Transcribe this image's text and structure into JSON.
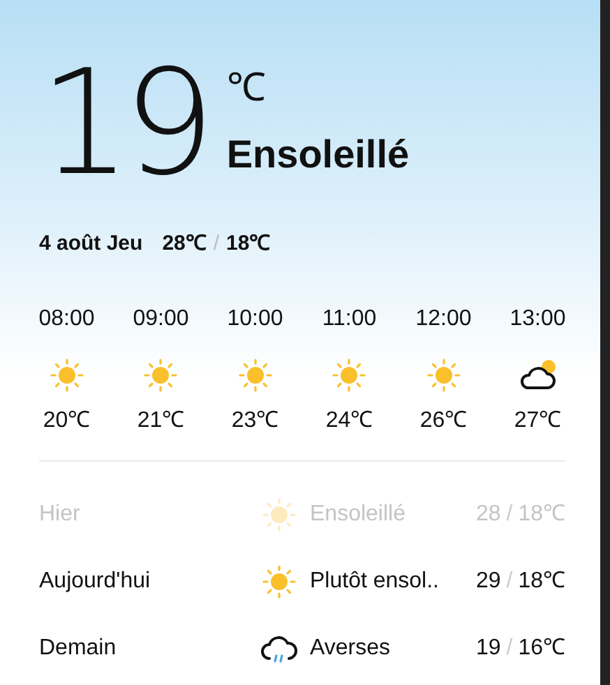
{
  "current": {
    "temperature": "19",
    "unit": "℃",
    "condition": "Ensoleillé"
  },
  "today": {
    "date": "4 août Jeu",
    "high": "28℃",
    "separator": "/",
    "low": "18℃"
  },
  "hourly": [
    {
      "time": "08:00",
      "kind": "sun",
      "temp": "20℃"
    },
    {
      "time": "09:00",
      "kind": "sun",
      "temp": "21℃"
    },
    {
      "time": "10:00",
      "kind": "sun",
      "temp": "23℃"
    },
    {
      "time": "11:00",
      "kind": "sun",
      "temp": "24℃"
    },
    {
      "time": "12:00",
      "kind": "sun",
      "temp": "26℃"
    },
    {
      "time": "13:00",
      "kind": "partly-cloudy",
      "temp": "27℃"
    }
  ],
  "daily": [
    {
      "day": "Hier",
      "past": true,
      "kind": "sun",
      "condition": "Ensoleillé",
      "high": "28",
      "separator": "/",
      "low": "18℃"
    },
    {
      "day": "Aujourd'hui",
      "past": false,
      "kind": "sun",
      "condition": "Plutôt ensol..",
      "high": "29",
      "separator": "/",
      "low": "18℃"
    },
    {
      "day": "Demain",
      "past": false,
      "kind": "rain",
      "condition": "Averses",
      "high": "19",
      "separator": "/",
      "low": "16℃"
    }
  ]
}
